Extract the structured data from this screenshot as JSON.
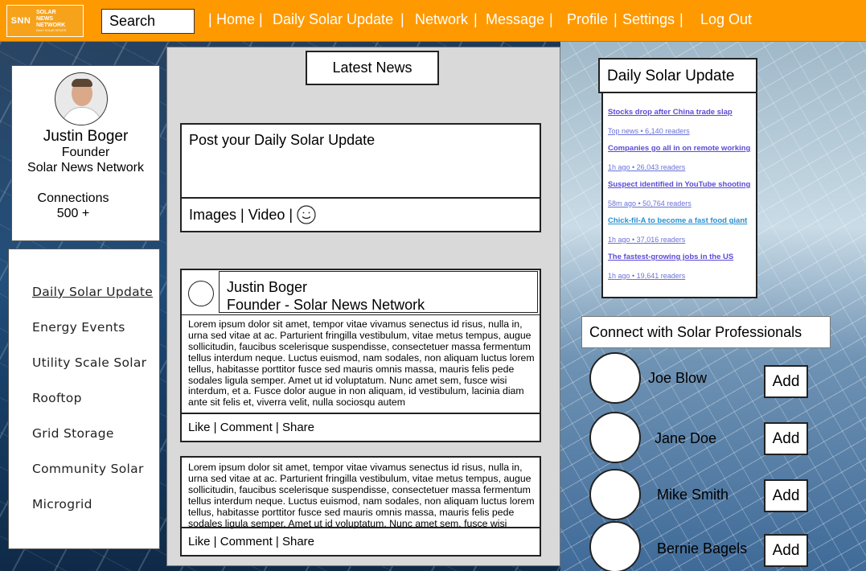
{
  "logo": {
    "mark": "SNN",
    "line1": "SOLAR",
    "line2": "NEWS",
    "line3": "NETWORK",
    "tagline": "DAILY SOLAR UPDATE"
  },
  "search": {
    "value": "Search"
  },
  "nav": [
    {
      "label": "Home"
    },
    {
      "label": "Daily Solar Update"
    },
    {
      "label": "Network"
    },
    {
      "label": "Message"
    },
    {
      "label": "Profile"
    },
    {
      "label": "Settings"
    },
    {
      "label": "Log Out"
    }
  ],
  "profile": {
    "name": "Justin Boger",
    "title": "Founder",
    "org": "Solar News Network",
    "connections_label": "Connections",
    "connections_value": "500 +"
  },
  "menu": [
    {
      "label": "Daily Solar Update"
    },
    {
      "label": "Energy Events"
    },
    {
      "label": "Utility Scale Solar"
    },
    {
      "label": "Rooftop"
    },
    {
      "label": "Grid Storage"
    },
    {
      "label": "Community Solar"
    },
    {
      "label": "Microgrid"
    }
  ],
  "feed": {
    "heading": "Latest News",
    "composer": {
      "prompt": "Post your Daily Solar Update",
      "tools": "Images | Video |"
    },
    "posts": [
      {
        "author": "Justin Boger",
        "role": "Founder - Solar News Network",
        "body": "Lorem ipsum dolor sit amet, tempor vitae vivamus senectus id risus, nulla in, urna sed vitae at ac. Parturient fringilla vestibulum, vitae metus tempus, augue sollicitudin, faucibus scelerisque suspendisse, consectetuer massa fermentum tellus interdum neque. Luctus euismod, nam sodales, non aliquam luctus lorem tellus, habitasse porttitor fusce sed mauris omnis massa, mauris felis pede sodales ligula semper. Amet ut id voluptatum. Nunc amet sem, fusce wisi interdum, et a. Fusce dolor augue in non aliquam, id vestibulum, lacinia diam ante sit felis et, viverra velit, nulla sociosqu autem",
        "actions": "Like | Comment | Share"
      },
      {
        "body": "Lorem ipsum dolor sit amet, tempor vitae vivamus senectus id risus, nulla in, urna sed vitae at ac. Parturient fringilla vestibulum, vitae metus tempus, augue sollicitudin, faucibus scelerisque suspendisse, consectetuer massa fermentum tellus interdum neque. Luctus euismod, nam sodales, non aliquam luctus lorem tellus, habitasse porttitor fusce sed mauris omnis massa, mauris felis pede sodales ligula semper. Amet ut id voluptatum. Nunc amet sem, fusce wisi",
        "actions": "Like | Comment | Share"
      }
    ]
  },
  "daily_update": {
    "title": "Daily Solar Update",
    "items": [
      {
        "headline": "Stocks drop after China trade slap",
        "meta": "Top news • 6,140 readers"
      },
      {
        "headline": "Companies go all in on remote working",
        "meta": "1h ago • 26,043 readers"
      },
      {
        "headline": "Suspect identified in YouTube shooting",
        "meta": "58m ago • 50,764 readers"
      },
      {
        "headline": "Chick-fil-A to become a fast food giant",
        "meta": "1h ago • 37,016 readers"
      },
      {
        "headline": "The fastest-growing jobs in the US",
        "meta": "1h ago • 19,641 readers"
      }
    ]
  },
  "connect": {
    "title": "Connect with Solar Professionals",
    "people": [
      {
        "name": "Joe Blow",
        "action": "Add"
      },
      {
        "name": "Jane Doe",
        "action": "Add"
      },
      {
        "name": "Mike Smith",
        "action": "Add"
      },
      {
        "name": "Bernie Bagels",
        "action": "Add"
      }
    ]
  },
  "colors": {
    "nav_bar": "#ff9900",
    "link": "#5b4bd6",
    "highlight_link": "#2a8fd0"
  }
}
